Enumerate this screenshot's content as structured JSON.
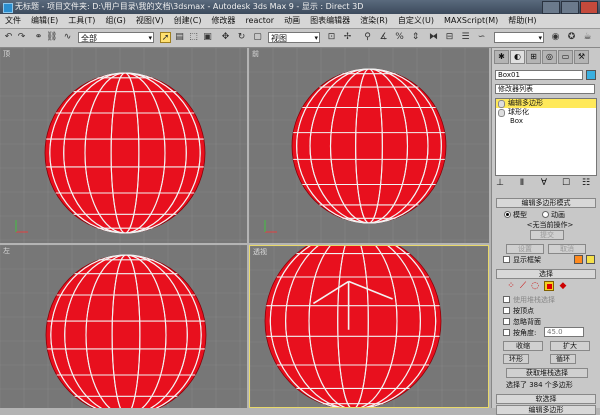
{
  "window": {
    "title": "无标题 - 项目文件夹: D:\\用户目录\\我的文档\\3dsmax - Autodesk 3ds Max 9 - 显示 : Direct 3D"
  },
  "menu": [
    "文件",
    "编辑(E)",
    "工具(T)",
    "组(G)",
    "视图(V)",
    "创建(C)",
    "修改器",
    "reactor",
    "动画",
    "图表编辑器",
    "渲染(R)",
    "自定义(U)",
    "MAXScript(M)",
    "帮助(H)"
  ],
  "toolbar": {
    "selection_filter": "全部",
    "ref_coord": "视图"
  },
  "viewports": {
    "top": "顶",
    "front": "前",
    "left": "左",
    "perspective": "透视"
  },
  "colors": {
    "sphere": "#e8101e",
    "wire": "#f2f2f2",
    "object_color": "#3ab0e0",
    "active_border": "#e8d86a"
  },
  "panel": {
    "object_name": "Box01",
    "modifier_list": "修改器列表",
    "stack": [
      "编辑多边形",
      "球形化",
      "Box"
    ],
    "rollout_mode": "编辑多边形模式",
    "mode_model": "模型",
    "mode_anim": "动画",
    "no_operation": "<无当前操作>",
    "commit": "提交",
    "settings": "设置",
    "cancel": "取消",
    "show_cage": "显示框架",
    "rollout_select": "选择",
    "use_stack_selection": "使用堆栈选择",
    "by_vertex": "按顶点",
    "ignore_backfacing": "忽略背面",
    "by_angle": "按角度:",
    "angle_value": "45.0",
    "shrink": "收缩",
    "grow": "扩大",
    "ring": "环形",
    "loop": "循环",
    "get_stack_selection": "获取堆栈选择",
    "selected_info": "选择了 384 个多边形",
    "rollout_soft": "软选择",
    "rollout_edit": "编辑多边形"
  }
}
